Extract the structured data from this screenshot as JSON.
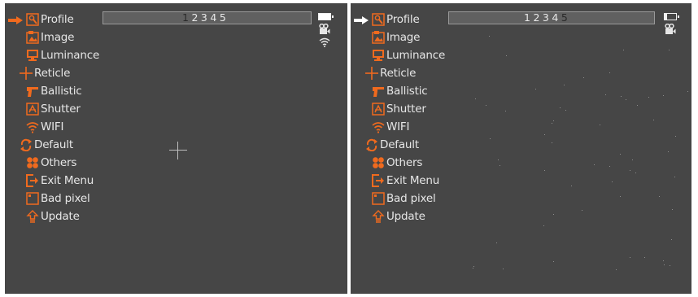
{
  "left_screen": {
    "menu": [
      {
        "label": "Profile",
        "icon": "wrench-icon"
      },
      {
        "label": "Image",
        "icon": "image-icon"
      },
      {
        "label": "Luminance",
        "icon": "monitor-icon"
      },
      {
        "label": "Reticle",
        "icon": "reticle-icon"
      },
      {
        "label": "Ballistic",
        "icon": "gun-icon"
      },
      {
        "label": "Shutter",
        "icon": "shutter-icon"
      },
      {
        "label": "WIFI",
        "icon": "wifi-icon"
      },
      {
        "label": "Default",
        "icon": "reset-icon"
      },
      {
        "label": "Others",
        "icon": "others-icon"
      },
      {
        "label": "Exit Menu",
        "icon": "exit-icon"
      },
      {
        "label": "Bad pixel",
        "icon": "bad-pixel-icon"
      },
      {
        "label": "Update",
        "icon": "update-icon"
      }
    ],
    "selected_item": "Profile",
    "profiles": [
      "1",
      "2",
      "3",
      "4",
      "5"
    ],
    "active_profile": "1",
    "status_icons": [
      "battery-icon",
      "video-camera-icon",
      "wifi-signal-icon"
    ]
  },
  "right_screen": {
    "menu": [
      {
        "label": "Profile",
        "icon": "wrench-icon"
      },
      {
        "label": "Image",
        "icon": "image-icon"
      },
      {
        "label": "Luminance",
        "icon": "monitor-icon"
      },
      {
        "label": "Reticle",
        "icon": "reticle-icon"
      },
      {
        "label": "Ballistic",
        "icon": "gun-icon"
      },
      {
        "label": "Shutter",
        "icon": "shutter-icon"
      },
      {
        "label": "WIFI",
        "icon": "wifi-icon"
      },
      {
        "label": "Default",
        "icon": "reset-icon"
      },
      {
        "label": "Others",
        "icon": "others-icon"
      },
      {
        "label": "Exit Menu",
        "icon": "exit-icon"
      },
      {
        "label": "Bad pixel",
        "icon": "bad-pixel-icon"
      },
      {
        "label": "Update",
        "icon": "update-icon"
      }
    ],
    "selected_item": "Profile",
    "profiles": [
      "1",
      "2",
      "3",
      "4",
      "5"
    ],
    "active_profile": "5",
    "status_icons": [
      "battery-icon",
      "video-camera-icon"
    ]
  },
  "colors": {
    "accent": "#f06a1e",
    "background": "#464646",
    "text": "#e6e6e6",
    "selected_arrow_left": "#f06a1e",
    "selected_arrow_right": "#ffffff"
  }
}
